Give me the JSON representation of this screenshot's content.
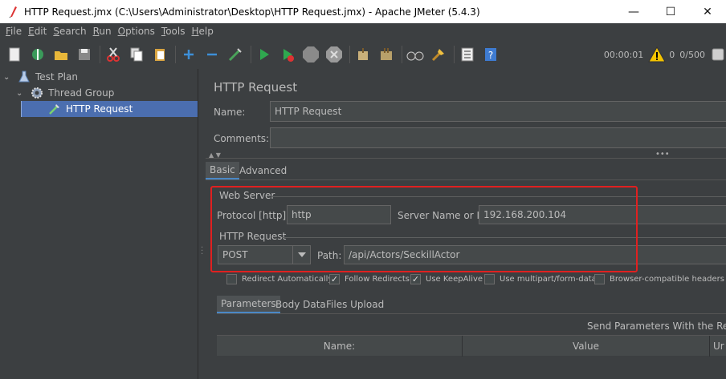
{
  "window": {
    "title": "HTTP Request.jmx (C:\\Users\\Administrator\\Desktop\\HTTP Request.jmx) - Apache JMeter (5.4.3)",
    "minimize": "—",
    "maximize": "☐",
    "close": "✕"
  },
  "menu": [
    {
      "label": "File",
      "key": "F",
      "rest": "ile"
    },
    {
      "label": "Edit",
      "key": "E",
      "rest": "dit"
    },
    {
      "label": "Search",
      "key": "S",
      "rest": "earch"
    },
    {
      "label": "Run",
      "key": "R",
      "rest": "un"
    },
    {
      "label": "Options",
      "key": "O",
      "rest": "ptions"
    },
    {
      "label": "Tools",
      "key": "T",
      "rest": "ools"
    },
    {
      "label": "Help",
      "key": "H",
      "rest": "elp"
    }
  ],
  "toolbar": {
    "timer": "00:00:01",
    "warning_count": "0",
    "threads": "0/500"
  },
  "tree": {
    "items": [
      {
        "label": "Test Plan",
        "icon": "flask-icon"
      },
      {
        "label": "Thread Group",
        "icon": "gear-icon"
      },
      {
        "label": "HTTP Request",
        "icon": "pipette-icon"
      }
    ]
  },
  "panel": {
    "title": "HTTP Request",
    "name_label": "Name:",
    "name_value": "HTTP Request",
    "comments_label": "Comments:",
    "comments_value": "",
    "tabs": [
      "Basic",
      "Advanced"
    ],
    "web_server_title": "Web Server",
    "protocol_label": "Protocol [http]:",
    "protocol_value": "http",
    "server_label": "Server Name or IP:",
    "server_value": "192.168.200.104",
    "http_request_title": "HTTP Request",
    "method_value": "POST",
    "path_label": "Path:",
    "path_value": "/api/Actors/SeckillActor",
    "checkboxes": [
      {
        "label": "Redirect Automatically",
        "checked": false
      },
      {
        "label": "Follow Redirects",
        "checked": true
      },
      {
        "label": "Use KeepAlive",
        "checked": true
      },
      {
        "label": "Use multipart/form-data",
        "checked": false
      },
      {
        "label": "Browser-compatible headers",
        "checked": false
      }
    ],
    "subtabs": [
      "Parameters",
      "Body Data",
      "Files Upload"
    ],
    "send_params_label": "Send Parameters With the Reque",
    "table_headers": [
      "Name:",
      "Value",
      "Ur"
    ]
  },
  "colors": {
    "highlight": "#e02020",
    "selected": "#4b6eaf",
    "background": "#3c3f41"
  }
}
